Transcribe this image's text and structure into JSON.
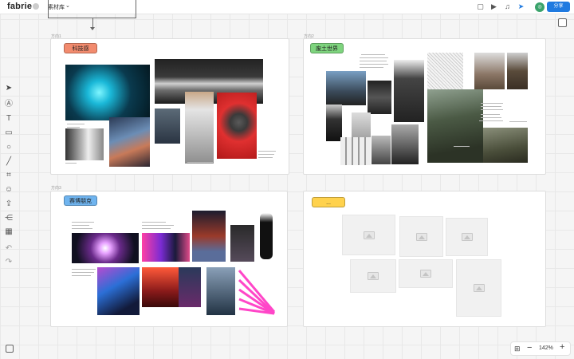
{
  "app": {
    "logo": "fabrie",
    "library_title": "素材库",
    "share_label": "分享",
    "avatar_initial": "◎"
  },
  "toolbar_right_icons": [
    "chat-icon",
    "present-icon",
    "bell-icon",
    "cursor-icon",
    "avatar"
  ],
  "left_tools": [
    "pointer-icon",
    "text-box-icon",
    "text-icon",
    "sticky-note-icon",
    "circle-icon",
    "line-icon",
    "frame-icon",
    "emoji-icon",
    "upload-icon",
    "mindmap-icon",
    "table-icon",
    "undo-icon",
    "redo-icon"
  ],
  "zoom": {
    "value": "142%"
  },
  "frames": [
    {
      "label": "方向1",
      "tag": "科技感",
      "tag_color": "#f28b6e"
    },
    {
      "label": "方向2",
      "tag": "废土世界",
      "tag_color": "#7ed47e"
    },
    {
      "label": "方向3",
      "tag": "赛博朋克",
      "tag_color": "#6fb4ef"
    },
    {
      "label": "",
      "tag": "...",
      "tag_color": "#ffd24d"
    }
  ]
}
